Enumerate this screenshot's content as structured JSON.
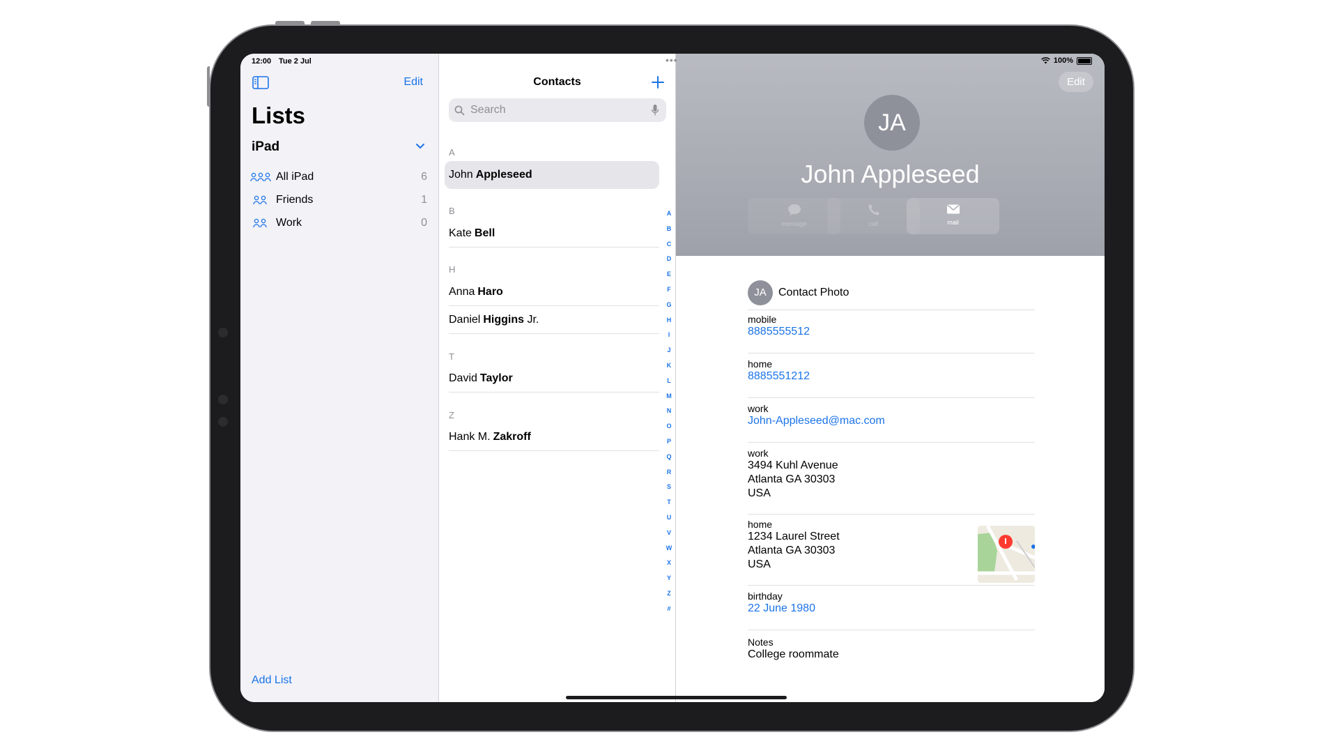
{
  "status": {
    "time": "12:00",
    "date": "Tue 2 Jul",
    "battery": "100%"
  },
  "sidebar": {
    "edit_label": "Edit",
    "title": "Lists",
    "group_label": "iPad",
    "items": [
      {
        "label": "All iPad",
        "count": "6"
      },
      {
        "label": "Friends",
        "count": "1"
      },
      {
        "label": "Work",
        "count": "0"
      }
    ],
    "add_list_label": "Add List"
  },
  "contacts": {
    "title": "Contacts",
    "search_placeholder": "Search",
    "sections": [
      {
        "letter": "A",
        "rows": [
          {
            "first": "John",
            "last": "Appleseed"
          }
        ]
      },
      {
        "letter": "B",
        "rows": [
          {
            "first": "Kate",
            "last": "Bell"
          }
        ]
      },
      {
        "letter": "H",
        "rows": [
          {
            "first": "Anna",
            "last": "Haro"
          },
          {
            "first": "Daniel",
            "last": "Higgins",
            "suffix": "Jr."
          }
        ]
      },
      {
        "letter": "T",
        "rows": [
          {
            "first": "David",
            "last": "Taylor"
          }
        ]
      },
      {
        "letter": "Z",
        "rows": [
          {
            "first": "Hank M.",
            "last": "Zakroff"
          }
        ]
      }
    ],
    "index_letters": [
      "A",
      "B",
      "C",
      "D",
      "E",
      "F",
      "G",
      "H",
      "I",
      "J",
      "K",
      "L",
      "M",
      "N",
      "O",
      "P",
      "Q",
      "R",
      "S",
      "T",
      "U",
      "V",
      "W",
      "X",
      "Y",
      "Z",
      "#"
    ]
  },
  "detail": {
    "edit_label": "Edit",
    "initials": "JA",
    "name": "John Appleseed",
    "actions": [
      {
        "label": "message",
        "icon": "message-icon",
        "enabled": false
      },
      {
        "label": "call",
        "icon": "phone-icon",
        "enabled": false
      },
      {
        "label": "mail",
        "icon": "mail-icon",
        "enabled": true
      }
    ],
    "photo_label": "Contact Photo",
    "fields": {
      "mobile": {
        "label": "mobile",
        "value": "8885555512"
      },
      "home_phone": {
        "label": "home",
        "value": "8885551212"
      },
      "work_email": {
        "label": "work",
        "value": "John-Appleseed@mac.com"
      },
      "work_address": {
        "label": "work",
        "lines": [
          "3494 Kuhl Avenue",
          "Atlanta GA 30303",
          "USA"
        ]
      },
      "home_address": {
        "label": "home",
        "lines": [
          "1234 Laurel Street",
          "Atlanta GA 30303",
          "USA"
        ]
      },
      "birthday": {
        "label": "birthday",
        "value": "22 June 1980"
      },
      "notes": {
        "label": "Notes",
        "value": "College roommate"
      }
    }
  },
  "colors": {
    "accent": "#1a73e8",
    "header_bg": "#b0b2ba",
    "sidebar_bg": "#f2f2f7"
  }
}
